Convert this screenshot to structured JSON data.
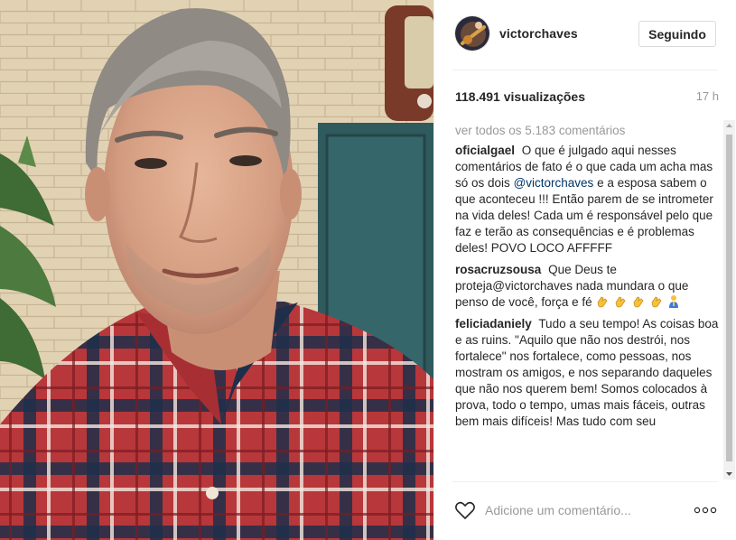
{
  "post": {
    "username": "victorchaves",
    "follow_label": "Seguindo",
    "views": "118.491 visualizações",
    "time_ago": "17 h"
  },
  "comments_section": {
    "view_all": "ver todos os 5.183 comentários",
    "items": [
      {
        "author": "oficialgael",
        "text_before": "O que é julgado aqui nesses comentários de fato é o que cada um acha mas só os dois",
        "mention": "@victorchaves",
        "text_after": "e a esposa sabem o que aconteceu !!! Então parem de se intrometer na vida deles! Cada um é responsável pelo que faz e terão as consequências e é problemas deles! POVO LOCO AFFFFF"
      },
      {
        "author": "rosacruzsousa",
        "text": "Que Deus te proteja@victorchaves nada mundara o que penso de você, força e fé",
        "emojis": [
          "clapping-hands-icon",
          "clapping-hands-icon",
          "clapping-hands-icon",
          "clapping-hands-icon",
          "person-praying-icon"
        ]
      },
      {
        "author": "feliciadaniely",
        "text": "Tudo a seu tempo! As coisas boa e as ruins. \"Aquilo que não nos destrói, nos fortalece\" nos fortalece, como pessoas, nos mostram os amigos, e nos separando daqueles que não nos querem bem! Somos colocados à prova, todo o tempo, umas mais fáceis, outras bem mais difíceis! Mas tudo com seu"
      }
    ]
  },
  "comment_bar": {
    "placeholder": "Adicione um comentário...",
    "more_icon": "more-options-icon",
    "like_icon": "heart-icon"
  },
  "colors": {
    "text": "#262626",
    "muted": "#999999",
    "mention": "#003569",
    "border": "#dbdbdb"
  }
}
